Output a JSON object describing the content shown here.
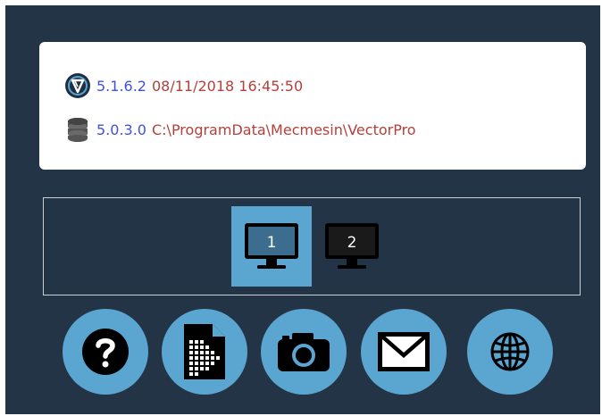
{
  "info": {
    "app": {
      "version": "5.1.6.2",
      "detail": "08/11/2018 16:45:50",
      "icon": "vector-app-icon"
    },
    "database": {
      "version": "5.0.3.0",
      "detail": "C:\\ProgramData\\Mecmesin\\VectorPro",
      "icon": "database-icon"
    },
    "version_color": "#3f51d6",
    "detail_color": "#b3403b"
  },
  "monitors": [
    {
      "label": "1",
      "selected": true
    },
    {
      "label": "2",
      "selected": false
    }
  ],
  "actions": [
    {
      "icon": "help-icon"
    },
    {
      "icon": "report-icon"
    },
    {
      "icon": "camera-icon"
    },
    {
      "icon": "mail-icon"
    },
    {
      "icon": "globe-icon"
    }
  ],
  "colors": {
    "background": "#243447",
    "accent": "#5aa6d0"
  }
}
